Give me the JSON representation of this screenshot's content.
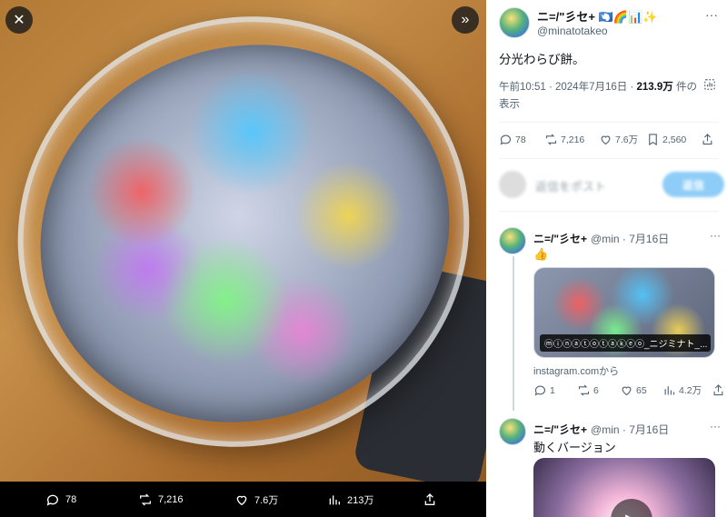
{
  "media_viewer": {
    "close_icon": "close-icon",
    "expand_icon": "double-chevron-right-icon",
    "bar": {
      "replies": "78",
      "reposts": "7,216",
      "likes": "7.6万",
      "views": "213万"
    }
  },
  "tweet": {
    "display_name": "ニ=/\"彡セ+ 🇦🇶🌈📊✨",
    "handle": "@minatotakeo",
    "text": "分光わらび餅。",
    "time": "午前10:51 · 2024年7月16日 · ",
    "views_count": "213.9万",
    "views_suffix": "件の表示",
    "actions": {
      "replies": "78",
      "reposts": "7,216",
      "likes": "7.6万",
      "bookmarks": "2,560"
    }
  },
  "reply_box": {
    "placeholder": "返信をポスト",
    "button": "返信"
  },
  "thread": [
    {
      "display_name": "ニ=/\"彡セ+",
      "meta": "@min · 7月16日",
      "text": "👍",
      "card_label": "ⓜⓘⓝⓐⓣⓞⓣⓐⓚⓔⓞ_ニジミナト_...",
      "source": "instagram.comから",
      "actions": {
        "replies": "1",
        "reposts": "6",
        "likes": "65",
        "views": "4.2万"
      }
    },
    {
      "display_name": "ニ=/\"彡セ+",
      "meta": "@min · 7月16日",
      "text": "動くバージョン"
    }
  ]
}
